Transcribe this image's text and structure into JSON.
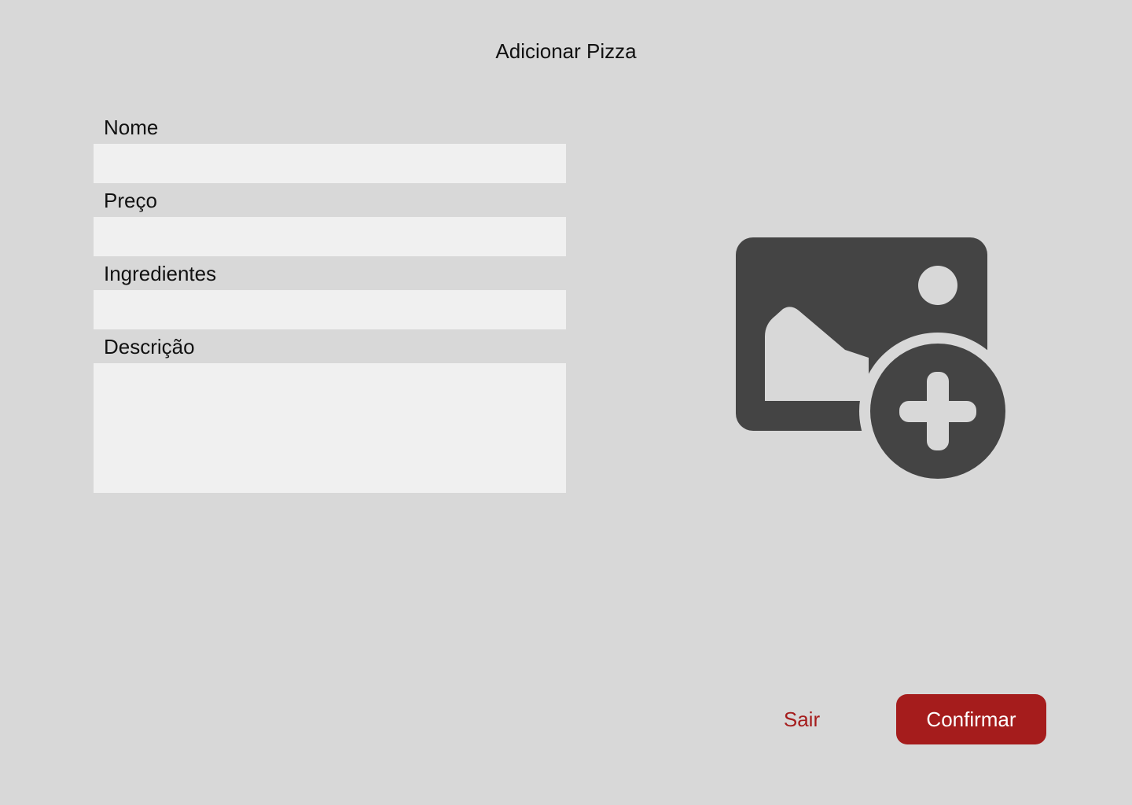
{
  "header": {
    "title": "Adicionar Pizza"
  },
  "form": {
    "fields": [
      {
        "label": "Nome",
        "value": "",
        "placeholder": ""
      },
      {
        "label": "Preço",
        "value": "",
        "placeholder": ""
      },
      {
        "label": "Ingredientes",
        "value": "",
        "placeholder": ""
      },
      {
        "label": "Descrição",
        "value": "",
        "placeholder": ""
      }
    ]
  },
  "image_upload": {
    "icon": "add-photo-icon",
    "icon_color": "#444444"
  },
  "actions": {
    "exit_label": "Sair",
    "confirm_label": "Confirmar"
  },
  "colors": {
    "background": "#d8d8d8",
    "input_background": "#f0f0f0",
    "accent": "#a51c1c"
  }
}
